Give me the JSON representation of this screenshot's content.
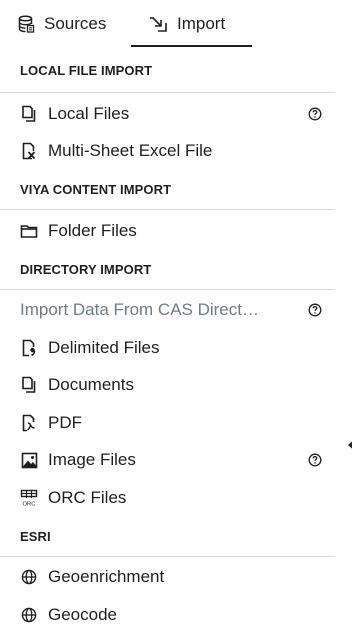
{
  "tabs": [
    {
      "label": "Sources",
      "icon": "database-icon",
      "selected": false
    },
    {
      "label": "Import",
      "icon": "import-arrow-icon",
      "selected": true
    }
  ],
  "sections": [
    {
      "header": "LOCAL FILE IMPORT",
      "items": [
        {
          "label": "Local Files",
          "icon": "file-copy-icon",
          "help": true
        },
        {
          "label": "Multi-Sheet Excel File",
          "icon": "excel-file-icon",
          "help": false
        }
      ]
    },
    {
      "header": "VIYA CONTENT IMPORT",
      "items": [
        {
          "label": "Folder Files",
          "icon": "folder-icon",
          "help": false
        }
      ]
    },
    {
      "header": "DIRECTORY IMPORT",
      "items": [
        {
          "label": "Import Data From CAS Direct…",
          "icon": "",
          "help": true,
          "muted": true
        },
        {
          "label": "Delimited Files",
          "icon": "delimited-file-icon",
          "help": false
        },
        {
          "label": "Documents",
          "icon": "documents-icon",
          "help": false
        },
        {
          "label": "PDF",
          "icon": "pdf-icon",
          "help": false
        },
        {
          "label": "Image Files",
          "icon": "image-icon",
          "help": true
        },
        {
          "label": "ORC Files",
          "icon": "orc-file-icon",
          "help": false,
          "icon_text": "ORC"
        }
      ]
    },
    {
      "header": "ESRI",
      "items": [
        {
          "label": "Geoenrichment",
          "icon": "globe-icon",
          "help": false
        },
        {
          "label": "Geocode",
          "icon": "globe-icon",
          "help": false
        }
      ]
    }
  ]
}
